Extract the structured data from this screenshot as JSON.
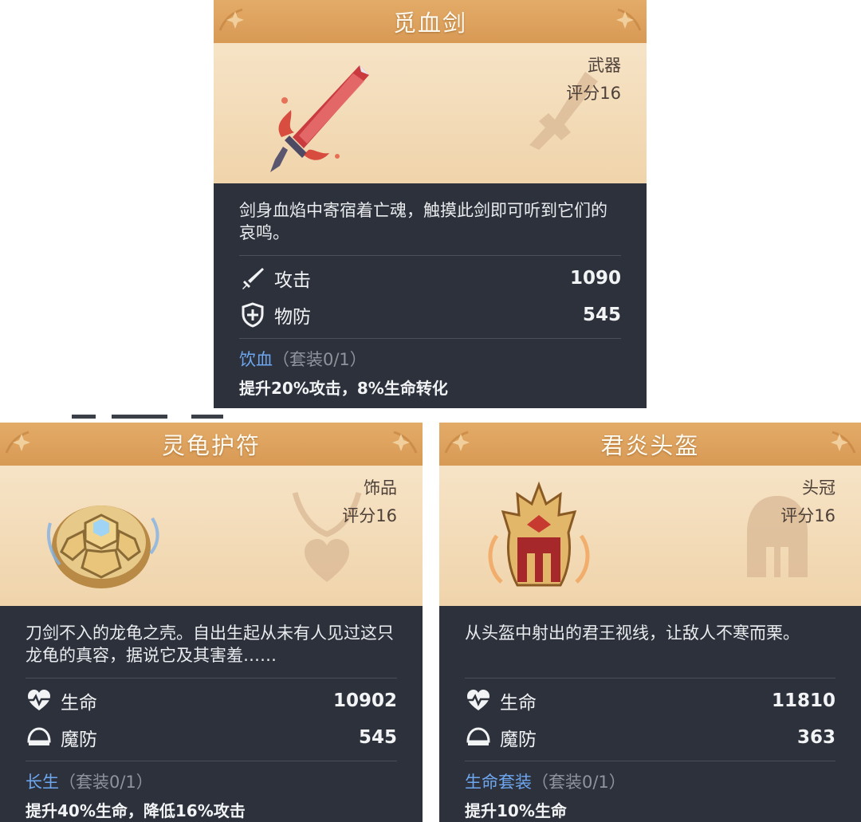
{
  "cards": [
    {
      "title": "觅血剑",
      "type": "武器",
      "score": "评分16",
      "description": "剑身血焰中寄宿着亡魂，触摸此剑即可听到它们的哀鸣。",
      "stats": [
        {
          "icon": "sword-icon",
          "name": "攻击",
          "value": "1090"
        },
        {
          "icon": "shield-icon",
          "name": "物防",
          "value": "545"
        }
      ],
      "set_name": "饮血",
      "set_count": "（套装0/1）",
      "set_effect": "提升20%攻击，8%生命转化"
    },
    {
      "title": "灵龟护符",
      "type": "饰品",
      "score": "评分16",
      "description": "刀剑不入的龙龟之壳。自出生起从未有人见过这只龙龟的真容，据说它及其害羞……",
      "stats": [
        {
          "icon": "heart-pulse-icon",
          "name": "生命",
          "value": "10902"
        },
        {
          "icon": "magic-defense-icon",
          "name": "魔防",
          "value": "545"
        }
      ],
      "set_name": "长生",
      "set_count": "（套装0/1）",
      "set_effect": "提升40%生命，降低16%攻击"
    },
    {
      "title": "君炎头盔",
      "type": "头冠",
      "score": "评分16",
      "description": "从头盔中射出的君王视线，让敌人不寒而栗。",
      "stats": [
        {
          "icon": "heart-pulse-icon",
          "name": "生命",
          "value": "11810"
        },
        {
          "icon": "magic-defense-icon",
          "name": "魔防",
          "value": "363"
        }
      ],
      "set_name": "生命套装",
      "set_count": "（套装0/1）",
      "set_effect": "提升10%生命"
    }
  ],
  "colors": {
    "header": "#dea260",
    "art_bg": "#f3dcb8",
    "panel": "#2c313b",
    "set_name": "#6ea7f0",
    "muted": "#8f949c"
  }
}
